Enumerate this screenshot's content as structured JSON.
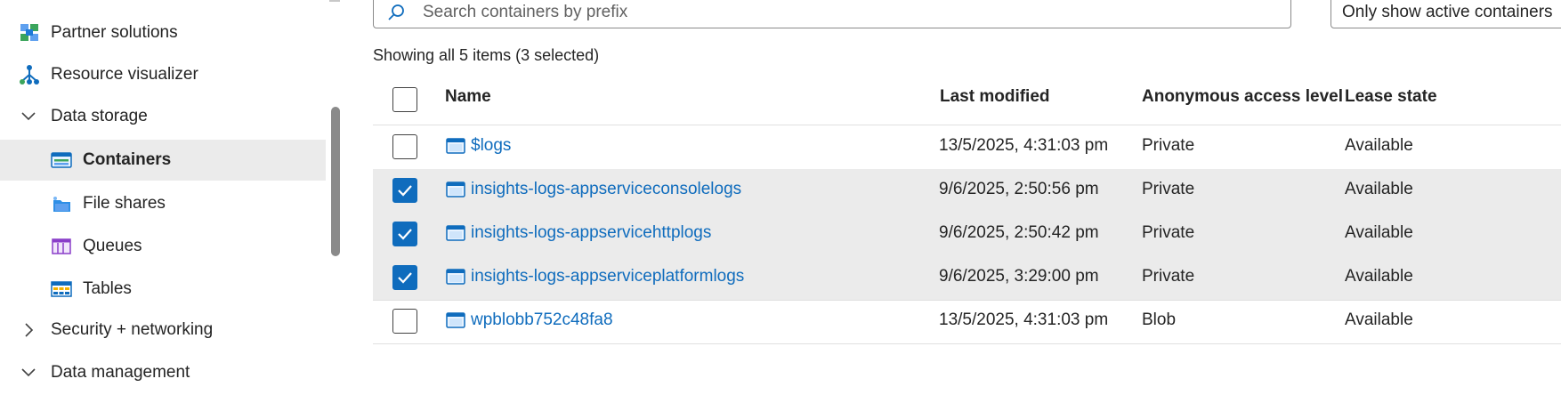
{
  "sidebar": {
    "items": [
      {
        "label": "Partner solutions",
        "icon": "partner-solutions-icon"
      },
      {
        "label": "Resource visualizer",
        "icon": "resource-visualizer-icon"
      },
      {
        "label": "Data storage",
        "expanded": true
      },
      {
        "label": "Containers",
        "icon": "containers-icon",
        "selected": true
      },
      {
        "label": "File shares",
        "icon": "file-shares-icon"
      },
      {
        "label": "Queues",
        "icon": "queues-icon"
      },
      {
        "label": "Tables",
        "icon": "tables-icon"
      },
      {
        "label": "Security + networking",
        "expanded": false
      },
      {
        "label": "Data management",
        "expanded": true
      }
    ]
  },
  "toolbar": {
    "search_placeholder": "Search containers by prefix",
    "active_filter_label": "Only show active containers"
  },
  "summary": "Showing all 5 items (3 selected)",
  "table": {
    "columns": [
      "Name",
      "Last modified",
      "Anonymous access level",
      "Lease state"
    ],
    "rows": [
      {
        "name": "$logs",
        "modified": "13/5/2025, 4:31:03 pm",
        "access": "Private",
        "lease": "Available",
        "selected": false
      },
      {
        "name": "insights-logs-appserviceconsolelogs",
        "modified": "9/6/2025, 2:50:56 pm",
        "access": "Private",
        "lease": "Available",
        "selected": true
      },
      {
        "name": "insights-logs-appservicehttplogs",
        "modified": "9/6/2025, 2:50:42 pm",
        "access": "Private",
        "lease": "Available",
        "selected": true
      },
      {
        "name": "insights-logs-appserviceplatformlogs",
        "modified": "9/6/2025, 3:29:00 pm",
        "access": "Private",
        "lease": "Available",
        "selected": true
      },
      {
        "name": "wpblobb752c48fa8",
        "modified": "13/5/2025, 4:31:03 pm",
        "access": "Blob",
        "lease": "Available",
        "selected": false
      }
    ]
  },
  "colors": {
    "accent": "#0f6cbd",
    "selected_bg": "#ebebeb"
  }
}
